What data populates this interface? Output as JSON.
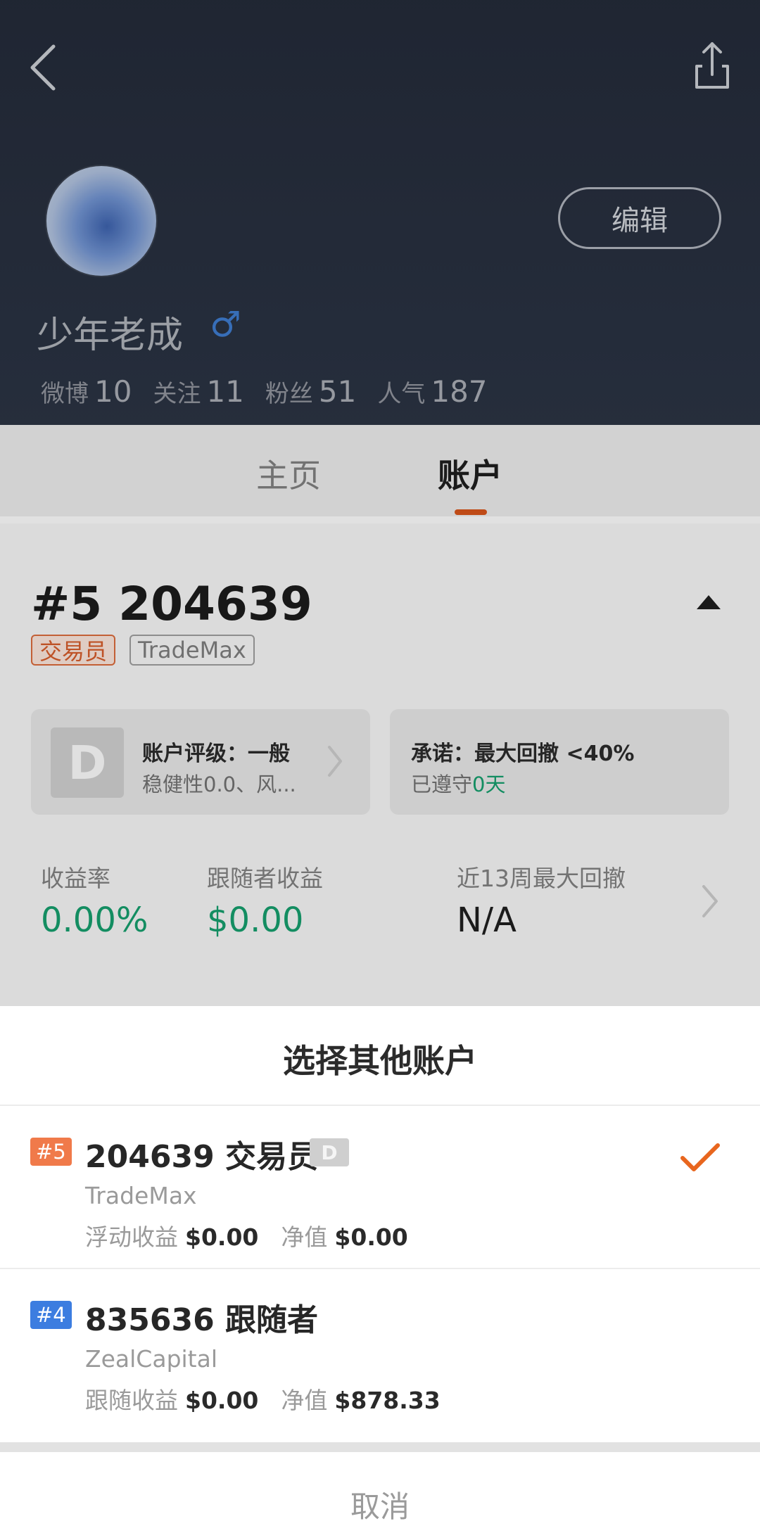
{
  "header": {
    "edit_label": "编辑",
    "username": "少年老成",
    "gender_symbol": "♂",
    "stats": [
      {
        "label": "微博",
        "value": "10"
      },
      {
        "label": "关注",
        "value": "11"
      },
      {
        "label": "粉丝",
        "value": "51"
      },
      {
        "label": "人气",
        "value": "187"
      }
    ]
  },
  "tabs": [
    {
      "label": "主页"
    },
    {
      "label": "账户",
      "active": true
    }
  ],
  "account": {
    "title": "#5 204639",
    "tags": [
      "交易员",
      "TradeMax"
    ],
    "rating_badge": "D",
    "rating_title": "账户评级：一般",
    "rating_sub": "稳健性0.0、风...",
    "promise_title": "承诺：最大回撤 <40%",
    "promise_sub_prefix": "已遵守",
    "promise_days": "0天",
    "metrics": [
      {
        "label": "收益率",
        "value": "0.00%"
      },
      {
        "label": "跟随者收益",
        "value": "$0.00"
      },
      {
        "label": "近13周最大回撤",
        "value": "N/A"
      }
    ]
  },
  "sheet": {
    "title": "选择其他账户",
    "accounts": [
      {
        "rank": "#5",
        "title": "204639 交易员",
        "badge": "D",
        "broker": "TradeMax",
        "label1": "浮动收益",
        "value1": "$0.00",
        "label2": "净值",
        "value2": "$0.00",
        "selected": true
      },
      {
        "rank": "#4",
        "title": "835636 跟随者",
        "broker": "ZealCapital",
        "label1": "跟随收益",
        "value1": "$0.00",
        "label2": "净值",
        "value2": "$878.33",
        "selected": false
      }
    ],
    "cancel_label": "取消"
  },
  "colors": {
    "accent": "#d0521a",
    "positive": "#159a6a",
    "rank5": "#f07a4a",
    "rank4": "#3c7de0"
  }
}
